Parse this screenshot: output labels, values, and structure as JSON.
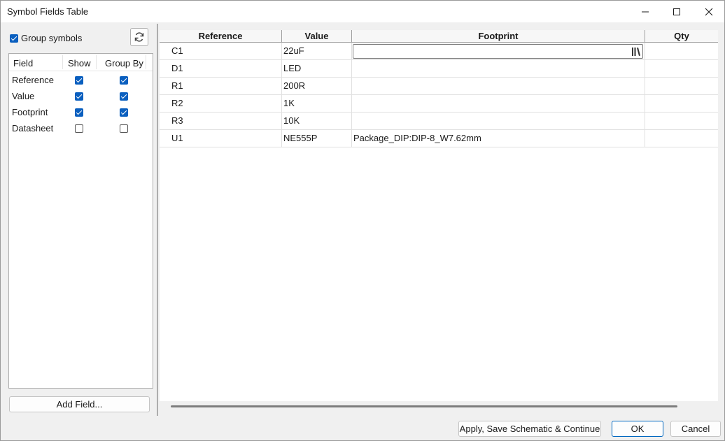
{
  "window": {
    "title": "Symbol Fields Table"
  },
  "group_symbols": {
    "label": "Group symbols",
    "checked": true
  },
  "fields_panel": {
    "headers": {
      "field": "Field",
      "show": "Show",
      "group_by": "Group By"
    },
    "rows": [
      {
        "name": "Reference",
        "show": true,
        "group_by": true
      },
      {
        "name": "Value",
        "show": true,
        "group_by": true
      },
      {
        "name": "Footprint",
        "show": true,
        "group_by": true
      },
      {
        "name": "Datasheet",
        "show": false,
        "group_by": false
      }
    ]
  },
  "add_field_label": "Add Field...",
  "table": {
    "columns": [
      "Reference",
      "Value",
      "Footprint",
      "Qty"
    ],
    "rows": [
      {
        "reference": "C1",
        "value": "22uF",
        "footprint": "",
        "qty": ""
      },
      {
        "reference": "D1",
        "value": "LED",
        "footprint": "",
        "qty": ""
      },
      {
        "reference": "R1",
        "value": "200R",
        "footprint": "",
        "qty": ""
      },
      {
        "reference": "R2",
        "value": "1K",
        "footprint": "",
        "qty": ""
      },
      {
        "reference": "R3",
        "value": "10K",
        "footprint": "",
        "qty": ""
      },
      {
        "reference": "U1",
        "value": "NE555P",
        "footprint": "Package_DIP:DIP-8_W7.62mm",
        "qty": ""
      }
    ]
  },
  "buttons": {
    "apply": "Apply, Save Schematic & Continue",
    "ok": "OK",
    "cancel": "Cancel"
  },
  "colors": {
    "accent": "#0a5fbf",
    "ok_border": "#0067c0"
  },
  "icons": {
    "refresh": "refresh-icon",
    "library_browse": "library-browse-icon"
  }
}
